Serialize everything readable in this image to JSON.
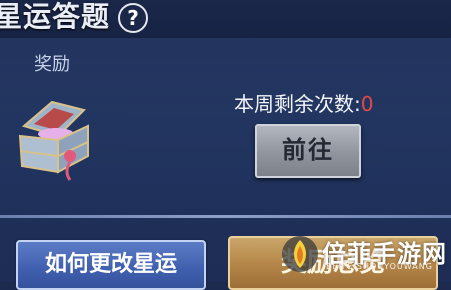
{
  "header": {
    "title": "星运答题",
    "help_label": "?"
  },
  "panel": {
    "reward_label": "奖励",
    "remaining_label": "本周剩余次数:",
    "remaining_count": "0",
    "goto_button": "前往"
  },
  "footer": {
    "how_button": "如何更改星运",
    "reward_button": "奖励总览"
  },
  "watermark": {
    "name": "倍菲手游网",
    "subtitle": "BEIFEISHOUYOUWANG"
  },
  "colors": {
    "count_red": "#e0494a",
    "how_button_blue": "#3f5fae",
    "reward_button_gold": "#b6884a"
  }
}
